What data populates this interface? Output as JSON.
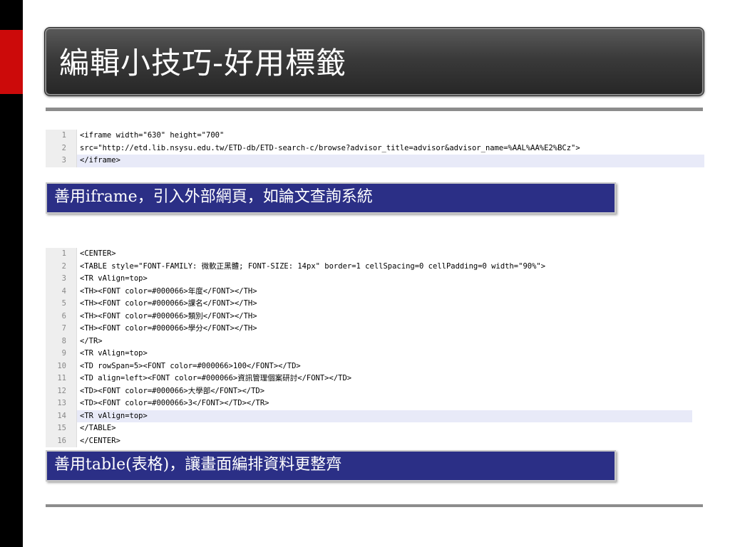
{
  "title": "編輯小技巧-好用標籤",
  "block1": {
    "lines": [
      {
        "num": "1",
        "text": "<iframe width=\"630\" height=\"700\""
      },
      {
        "num": "2",
        "text": "src=\"http://etd.lib.nsysu.edu.tw/ETD-db/ETD-search-c/browse?advisor_title=advisor&advisor_name=%AAL%AA%E2%BCz\">"
      },
      {
        "num": "3",
        "text": "</iframe>"
      }
    ],
    "caption": "善用iframe，引入外部網頁，如論文查詢系統"
  },
  "block2": {
    "lines": [
      {
        "num": "1",
        "text": "<CENTER>"
      },
      {
        "num": "2",
        "text": "<TABLE style=\"FONT-FAMILY: 微軟正黑體; FONT-SIZE: 14px\" border=1 cellSpacing=0 cellPadding=0 width=\"90%\">"
      },
      {
        "num": "3",
        "text": "<TR vAlign=top>"
      },
      {
        "num": "4",
        "text": "<TH><FONT color=#000066>年度</FONT></TH>"
      },
      {
        "num": "5",
        "text": "<TH><FONT color=#000066>課名</FONT></TH>"
      },
      {
        "num": "6",
        "text": "<TH><FONT color=#000066>類別</FONT></TH>"
      },
      {
        "num": "7",
        "text": "<TH><FONT color=#000066>學分</FONT></TH>"
      },
      {
        "num": "8",
        "text": "</TR>"
      },
      {
        "num": "9",
        "text": "<TR vAlign=top>"
      },
      {
        "num": "10",
        "text": "<TD rowSpan=5><FONT color=#000066>100</FONT></TD>"
      },
      {
        "num": "11",
        "text": "<TD align=left><FONT color=#000066>資訊管理個案研討</FONT></TD>"
      },
      {
        "num": "12",
        "text": "<TD><FONT color=#000066>大學部</FONT></TD>"
      },
      {
        "num": "13",
        "text": "<TD><FONT color=#000066>3</FONT></TD></TR>"
      },
      {
        "num": "14",
        "text": "<TR vAlign=top>"
      },
      {
        "num": "15",
        "text": "</TABLE>"
      },
      {
        "num": "16",
        "text": "</CENTER>"
      }
    ],
    "caption": "善用table(表格)，讓畫面編排資料更整齊"
  }
}
